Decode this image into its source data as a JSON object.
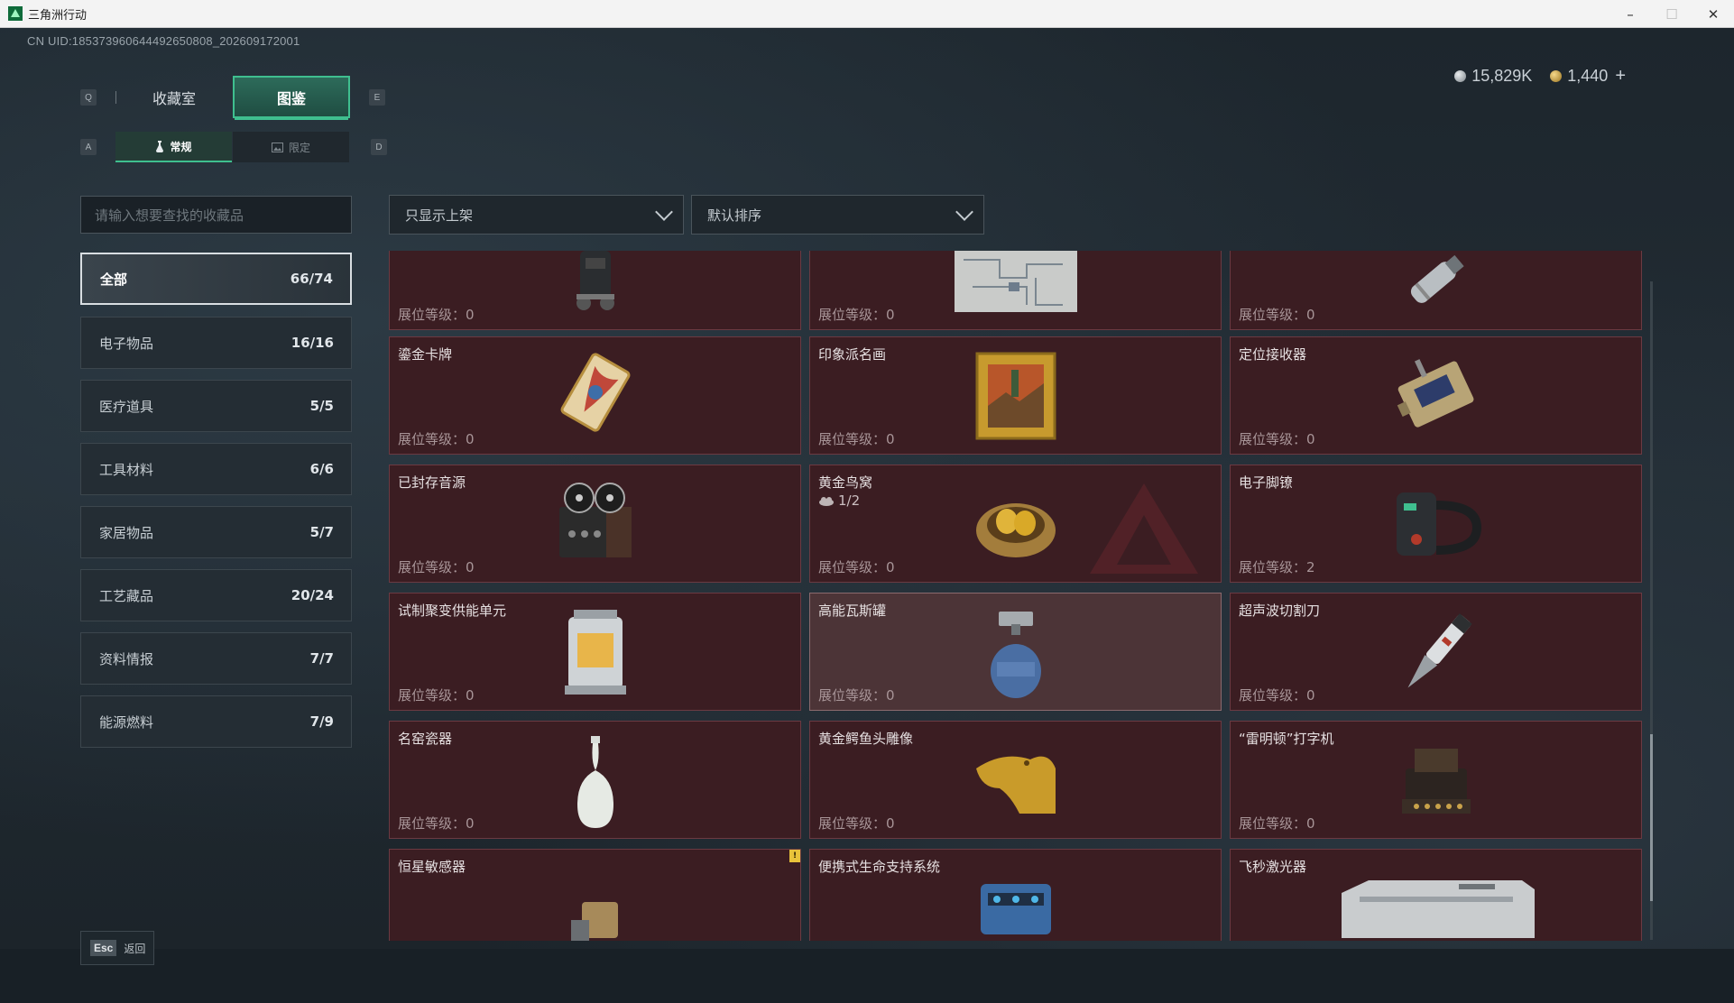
{
  "window": {
    "title": "三角洲行动",
    "minimize": "–",
    "maximize": "☐",
    "close": "✕"
  },
  "uid": "CN UID:185373960644492650808_202609172001",
  "currency": {
    "silver": "15,829K",
    "gold": "1,440",
    "plus": "+"
  },
  "keys": {
    "q": "Q",
    "e": "E",
    "a": "A",
    "d": "D"
  },
  "tabs": [
    {
      "label": "收藏室"
    },
    {
      "label": "图鉴"
    }
  ],
  "subtabs": [
    {
      "label": "常规"
    },
    {
      "label": "限定"
    }
  ],
  "search": {
    "placeholder": "请输入想要查找的收藏品"
  },
  "filters": {
    "shelf": "只显示上架",
    "sort": "默认排序"
  },
  "categories": [
    {
      "label": "全部",
      "count": "66/74"
    },
    {
      "label": "电子物品",
      "count": "16/16"
    },
    {
      "label": "医疗道具",
      "count": "5/5"
    },
    {
      "label": "工具材料",
      "count": "6/6"
    },
    {
      "label": "家居物品",
      "count": "5/7"
    },
    {
      "label": "工艺藏品",
      "count": "20/24"
    },
    {
      "label": "资料情报",
      "count": "7/7"
    },
    {
      "label": "能源燃料",
      "count": "7/9"
    }
  ],
  "level_label": "展位等级：",
  "cards": [
    {
      "name": "",
      "level": "0",
      "icon": "robot-icon"
    },
    {
      "name": "",
      "level": "0",
      "icon": "map-icon"
    },
    {
      "name": "",
      "level": "0",
      "icon": "canister-icon"
    },
    {
      "name": "鎏金卡牌",
      "level": "0",
      "icon": "card-icon"
    },
    {
      "name": "印象派名画",
      "level": "0",
      "icon": "painting-icon"
    },
    {
      "name": "定位接收器",
      "level": "0",
      "icon": "receiver-icon"
    },
    {
      "name": "已封存音源",
      "level": "0",
      "icon": "tape-recorder-icon"
    },
    {
      "name": "黄金鸟窝",
      "level": "0",
      "fraction": "1/2",
      "icon": "nest-icon"
    },
    {
      "name": "电子脚镣",
      "level": "2",
      "icon": "anklet-icon"
    },
    {
      "name": "试制聚变供能单元",
      "level": "0",
      "icon": "fusion-cell-icon"
    },
    {
      "name": "高能瓦斯罐",
      "level": "0",
      "icon": "gas-tank-icon"
    },
    {
      "name": "超声波切割刀",
      "level": "0",
      "icon": "knife-icon"
    },
    {
      "name": "名窑瓷器",
      "level": "0",
      "icon": "vase-icon"
    },
    {
      "name": "黄金鳄鱼头雕像",
      "level": "0",
      "icon": "crocodile-icon"
    },
    {
      "name": "“雷明顿”打字机",
      "level": "0",
      "icon": "typewriter-icon"
    },
    {
      "name": "恒星敏感器",
      "level": "",
      "icon": "sensor-icon"
    },
    {
      "name": "便携式生命支持系统",
      "level": "",
      "icon": "life-support-icon"
    },
    {
      "name": "飞秒激光器",
      "level": "",
      "icon": "laser-icon"
    }
  ],
  "badge": "!",
  "bottom": {
    "esc_key": "Esc",
    "back_label": "返回"
  },
  "colors": {
    "accent": "#3fbf8f",
    "card_bg": "#3b1d22",
    "card_border": "#6b3a42"
  }
}
